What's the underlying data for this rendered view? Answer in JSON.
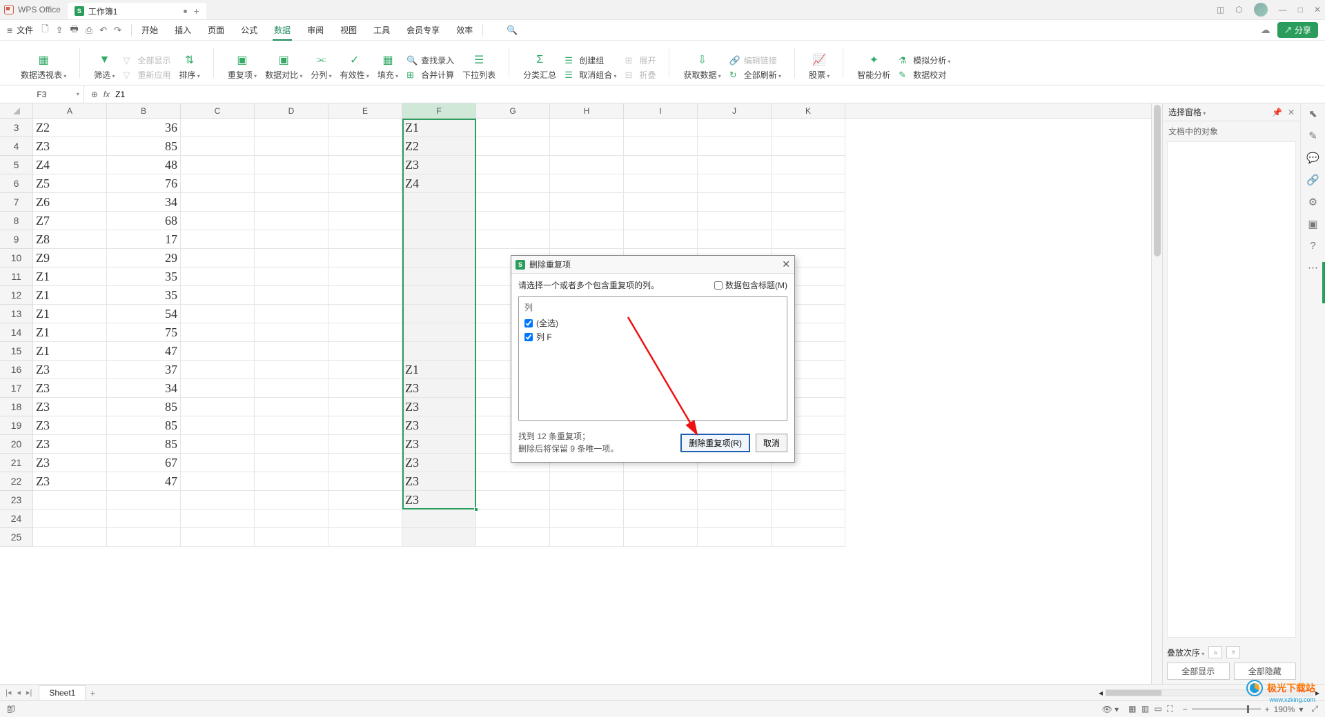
{
  "app_name": "WPS Office",
  "doc_tab": {
    "icon_letter": "S",
    "title": "工作簿1"
  },
  "title_actions": {
    "plus": "+"
  },
  "menubar": {
    "file": "文件",
    "tabs": [
      "开始",
      "插入",
      "页面",
      "公式",
      "数据",
      "审阅",
      "视图",
      "工具",
      "会员专享",
      "效率"
    ],
    "active_index": 4,
    "share": "分享"
  },
  "ribbon": {
    "pivot": "数据透视表",
    "filter": "筛选",
    "show_all": "全部显示",
    "refilter": "重新应用",
    "sort": "排序",
    "dup": "重复项",
    "compare": "数据对比",
    "split": "分列",
    "validity": "有效性",
    "fill": "填充",
    "find_input": "查找录入",
    "consolidate": "合并计算",
    "dropdown": "下拉列表",
    "subtotal": "分类汇总",
    "group": "创建组",
    "ungroup": "取消组合",
    "expand": "展开",
    "collapse": "折叠",
    "getdata": "获取数据",
    "edit_link": "编辑链接",
    "refresh_all": "全部刷新",
    "stock": "股票",
    "smart": "智能分析",
    "sim": "模拟分析",
    "calibrate": "数据校对"
  },
  "namebox": "F3",
  "formula": "Z1",
  "columns": [
    "A",
    "B",
    "C",
    "D",
    "E",
    "F",
    "G",
    "H",
    "I",
    "J",
    "K"
  ],
  "sel_col_index": 5,
  "rows": [
    {
      "n": 3,
      "A": "Z2",
      "B": "36",
      "F": "Z1"
    },
    {
      "n": 4,
      "A": "Z3",
      "B": "85",
      "F": "Z2"
    },
    {
      "n": 5,
      "A": "Z4",
      "B": "48",
      "F": "Z3"
    },
    {
      "n": 6,
      "A": "Z5",
      "B": "76",
      "F": "Z4"
    },
    {
      "n": 7,
      "A": "Z6",
      "B": "34",
      "F": ""
    },
    {
      "n": 8,
      "A": "Z7",
      "B": "68",
      "F": ""
    },
    {
      "n": 9,
      "A": "Z8",
      "B": "17",
      "F": ""
    },
    {
      "n": 10,
      "A": "Z9",
      "B": "29",
      "F": ""
    },
    {
      "n": 11,
      "A": "Z1",
      "B": "35",
      "F": ""
    },
    {
      "n": 12,
      "A": "Z1",
      "B": "35",
      "F": ""
    },
    {
      "n": 13,
      "A": "Z1",
      "B": "54",
      "F": ""
    },
    {
      "n": 14,
      "A": "Z1",
      "B": "75",
      "F": ""
    },
    {
      "n": 15,
      "A": "Z1",
      "B": "47",
      "F": ""
    },
    {
      "n": 16,
      "A": "Z3",
      "B": "37",
      "F": "Z1"
    },
    {
      "n": 17,
      "A": "Z3",
      "B": "34",
      "F": "Z3"
    },
    {
      "n": 18,
      "A": "Z3",
      "B": "85",
      "F": "Z3"
    },
    {
      "n": 19,
      "A": "Z3",
      "B": "85",
      "F": "Z3"
    },
    {
      "n": 20,
      "A": "Z3",
      "B": "85",
      "F": "Z3"
    },
    {
      "n": 21,
      "A": "Z3",
      "B": "67",
      "F": "Z3"
    },
    {
      "n": 22,
      "A": "Z3",
      "B": "47",
      "F": "Z3"
    },
    {
      "n": 23,
      "A": "",
      "B": "",
      "F": "Z3"
    },
    {
      "n": 24,
      "A": "",
      "B": "",
      "F": ""
    },
    {
      "n": 25,
      "A": "",
      "B": "",
      "F": ""
    }
  ],
  "f_range_top_row": 0,
  "f_range_bot_row": 20,
  "panel": {
    "title": "选择窗格",
    "sub": "文档中的对象",
    "stack": "叠放次序",
    "show_all": "全部显示",
    "hide_all": "全部隐藏"
  },
  "sheet": {
    "name": "Sheet1"
  },
  "status": {
    "icon": "卽",
    "zoom": "190%"
  },
  "dialog": {
    "title": "删除重复项",
    "prompt": "请选择一个或者多个包含重复项的列。",
    "header_check": "数据包含标题(M)",
    "col_header": "列",
    "select_all": "(全选)",
    "col_f": "列 F",
    "found1": "找到 12 条重复项；",
    "found2": "删除后将保留 9 条唯一项。",
    "remove": "删除重复项(R)",
    "cancel": "取消"
  },
  "watermark": {
    "text": "极光下载站",
    "sub": "www.xzking.com"
  }
}
